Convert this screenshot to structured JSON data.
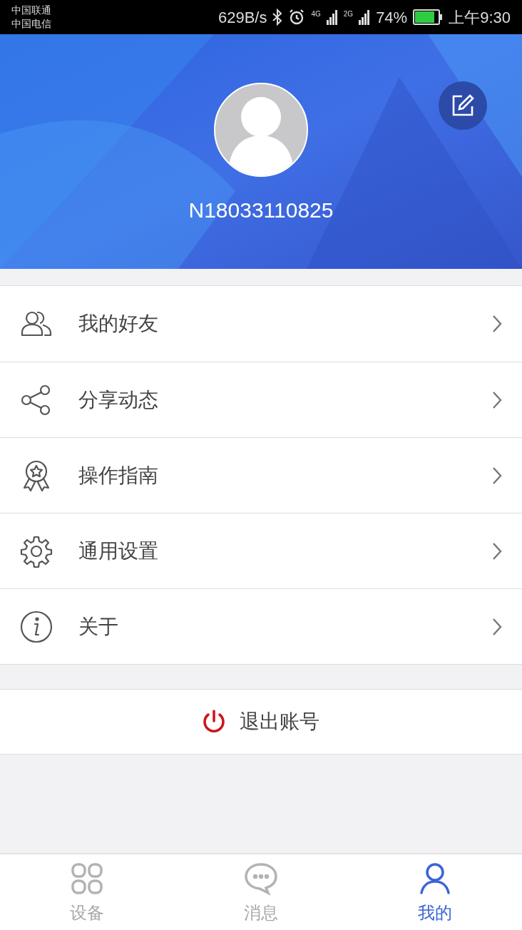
{
  "status_bar": {
    "carriers": [
      "中国联通",
      "中国电信"
    ],
    "speed": "629B/s",
    "net_1": "4G",
    "net_2": "2G",
    "battery": "74%",
    "time": "上午9:30"
  },
  "profile": {
    "username": "N18033110825"
  },
  "menu": [
    {
      "label": "我的好友"
    },
    {
      "label": "分享动态"
    },
    {
      "label": "操作指南"
    },
    {
      "label": "通用设置"
    },
    {
      "label": "关于"
    }
  ],
  "logout": {
    "label": "退出账号"
  },
  "tabs": [
    {
      "label": "设备",
      "selected": false
    },
    {
      "label": "消息",
      "selected": false
    },
    {
      "label": "我的",
      "selected": true
    }
  ]
}
